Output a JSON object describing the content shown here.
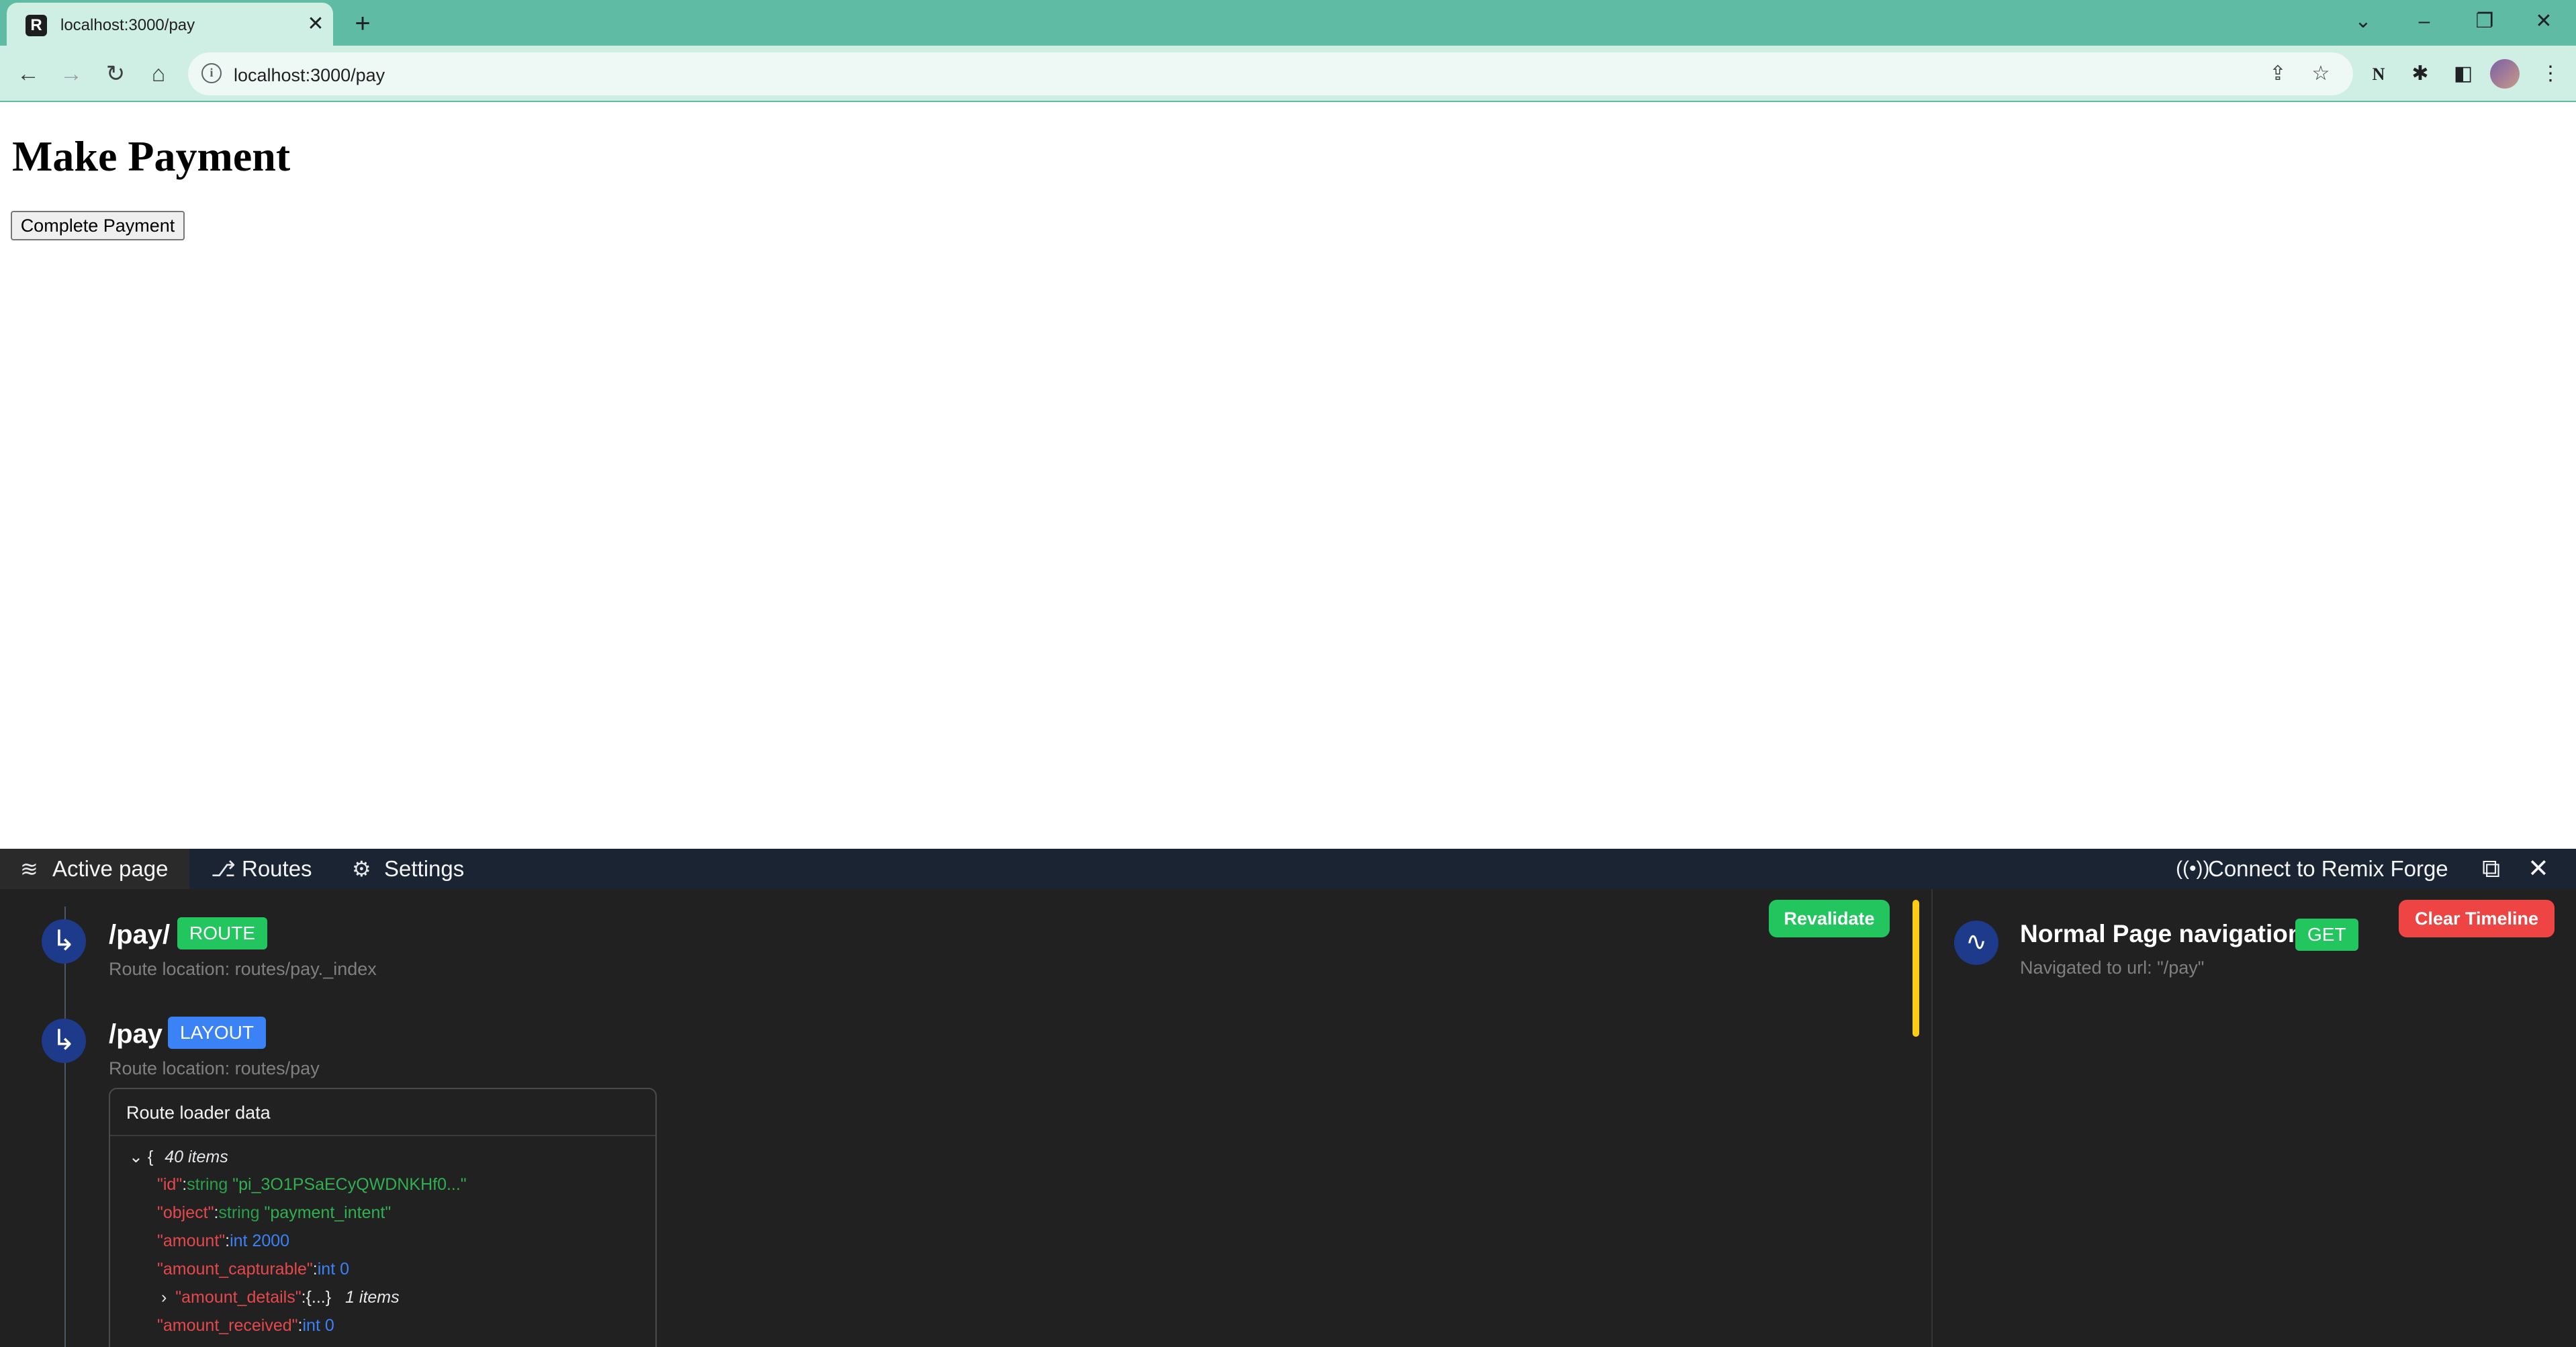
{
  "browser": {
    "tab_title": "localhost:3000/pay",
    "favicon_glyph": "R",
    "url": "localhost:3000/pay",
    "new_tab_glyph": "+",
    "close_glyph": "✕"
  },
  "page": {
    "heading": "Make Payment",
    "complete_button": "Complete Payment"
  },
  "devtools": {
    "tabs": [
      {
        "label": "Active page",
        "icon": "layers-icon"
      },
      {
        "label": "Routes",
        "icon": "route-icon"
      },
      {
        "label": "Settings",
        "icon": "gear-icon"
      }
    ],
    "connect_label": "Connect to Remix Forge",
    "revalidate_label": "Revalidate",
    "routes": [
      {
        "path": "/pay/",
        "badge": "ROUTE",
        "location": "Route location: routes/pay._index"
      },
      {
        "path": "/pay",
        "badge": "LAYOUT",
        "location": "Route location: routes/pay"
      }
    ],
    "loader": {
      "title": "Route loader data",
      "brace": "{",
      "count": "40 items",
      "entries": [
        {
          "key": "\"id\"",
          "colon": ":",
          "type": "string",
          "value": "\"pi_3O1PSaECyQWDNKHf0...\""
        },
        {
          "key": "\"object\"",
          "colon": ":",
          "type": "string",
          "value": "\"payment_intent\""
        },
        {
          "key": "\"amount\"",
          "colon": ":",
          "type": "int",
          "value": "2000"
        },
        {
          "key": "\"amount_capturable\"",
          "colon": ":",
          "type": "int",
          "value": "0"
        },
        {
          "key": "\"amount_details\"",
          "colon": ":",
          "type": "{...}",
          "value": "1 items"
        },
        {
          "key": "\"amount_received\"",
          "colon": ":",
          "type": "int",
          "value": "0"
        }
      ]
    },
    "timeline": {
      "title": "Normal Page navigation",
      "method": "GET",
      "subtitle": "Navigated to url: \"/pay\"",
      "clear_label": "Clear Timeline"
    },
    "colors": {
      "route_badge": "#22c55e",
      "layout_badge": "#3b82f6",
      "revalidate": "#22c55e",
      "clear": "#ef4444",
      "scroll_thumb": "#facc15"
    }
  }
}
